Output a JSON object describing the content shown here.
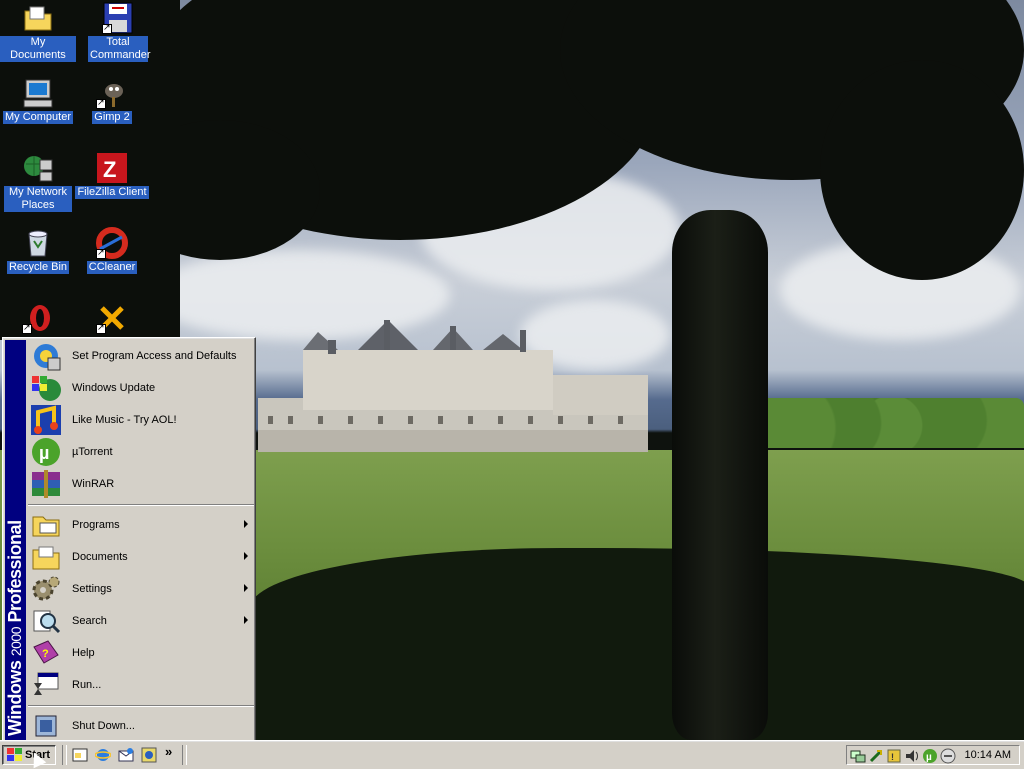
{
  "desktop": {
    "icons": [
      {
        "label": "My Documents",
        "icon": "folder-documents-icon"
      },
      {
        "label": "Total Commander",
        "icon": "floppy-disk-icon"
      },
      {
        "label": "My Computer",
        "icon": "computer-icon"
      },
      {
        "label": "Gimp 2",
        "icon": "gimp-icon"
      },
      {
        "label": "My Network Places",
        "icon": "network-places-icon"
      },
      {
        "label": "FileZilla Client",
        "icon": "filezilla-icon"
      },
      {
        "label": "Recycle Bin",
        "icon": "recycle-bin-icon"
      },
      {
        "label": "CCleaner",
        "icon": "ccleaner-icon"
      },
      {
        "label": "",
        "icon": "opera-icon"
      },
      {
        "label": "",
        "icon": "tools-icon"
      }
    ]
  },
  "start_menu": {
    "banner": {
      "part1": "Windows",
      "part2": "2000",
      "part3": "Professional"
    },
    "pinned": [
      {
        "label": "Set Program Access and Defaults",
        "icon": "program-access-icon"
      },
      {
        "label": "Windows Update",
        "icon": "windows-update-icon"
      },
      {
        "label": "Like Music - Try AOL!",
        "icon": "aol-music-icon"
      },
      {
        "label": "µTorrent",
        "icon": "utorrent-icon"
      },
      {
        "label": "WinRAR",
        "icon": "winrar-icon"
      }
    ],
    "main": [
      {
        "label": "Programs",
        "icon": "programs-icon",
        "submenu": true
      },
      {
        "label": "Documents",
        "icon": "documents-folder-icon",
        "submenu": true
      },
      {
        "label": "Settings",
        "icon": "settings-icon",
        "submenu": true
      },
      {
        "label": "Search",
        "icon": "search-icon",
        "submenu": true
      },
      {
        "label": "Help",
        "icon": "help-book-icon",
        "submenu": false
      },
      {
        "label": "Run...",
        "icon": "run-icon",
        "submenu": false
      }
    ],
    "shutdown": {
      "label": "Shut Down...",
      "icon": "shutdown-icon"
    }
  },
  "taskbar": {
    "start_label": "Start",
    "quick_launch": [
      "show-desktop-icon",
      "internet-explorer-icon",
      "outlook-express-icon",
      "media-icon"
    ],
    "tray_icons": [
      "network-icon",
      "power-icon",
      "security-icon",
      "volume-icon",
      "utorrent-tray-icon",
      "updates-icon"
    ],
    "clock": "10:14 AM"
  }
}
